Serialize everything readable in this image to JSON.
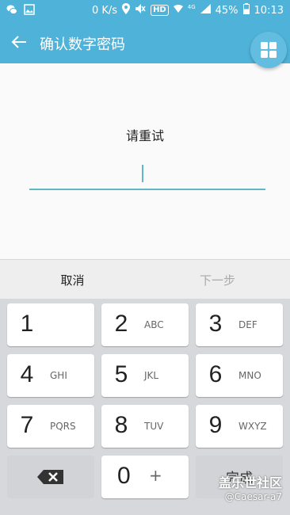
{
  "status_bar": {
    "net_speed": "0 K/s",
    "hd": "HD",
    "net_type": "4G",
    "battery": "45%",
    "time": "10:13"
  },
  "app_bar": {
    "title": "确认数字密码"
  },
  "prompt": "请重试",
  "actions": {
    "cancel": "取消",
    "next": "下一步"
  },
  "keypad": {
    "keys": [
      {
        "num": "1",
        "letters": ""
      },
      {
        "num": "2",
        "letters": "ABC"
      },
      {
        "num": "3",
        "letters": "DEF"
      },
      {
        "num": "4",
        "letters": "GHI"
      },
      {
        "num": "5",
        "letters": "JKL"
      },
      {
        "num": "6",
        "letters": "MNO"
      },
      {
        "num": "7",
        "letters": "PQRS"
      },
      {
        "num": "8",
        "letters": "TUV"
      },
      {
        "num": "9",
        "letters": "WXYZ"
      }
    ],
    "zero": {
      "num": "0",
      "letters": "+"
    },
    "done": "完成"
  },
  "watermark": {
    "line1": "盖乐世社区",
    "line2": "@Caesar-a7"
  },
  "colors": {
    "accent": "#4fb3d9",
    "field_line": "#5fb8c4"
  }
}
